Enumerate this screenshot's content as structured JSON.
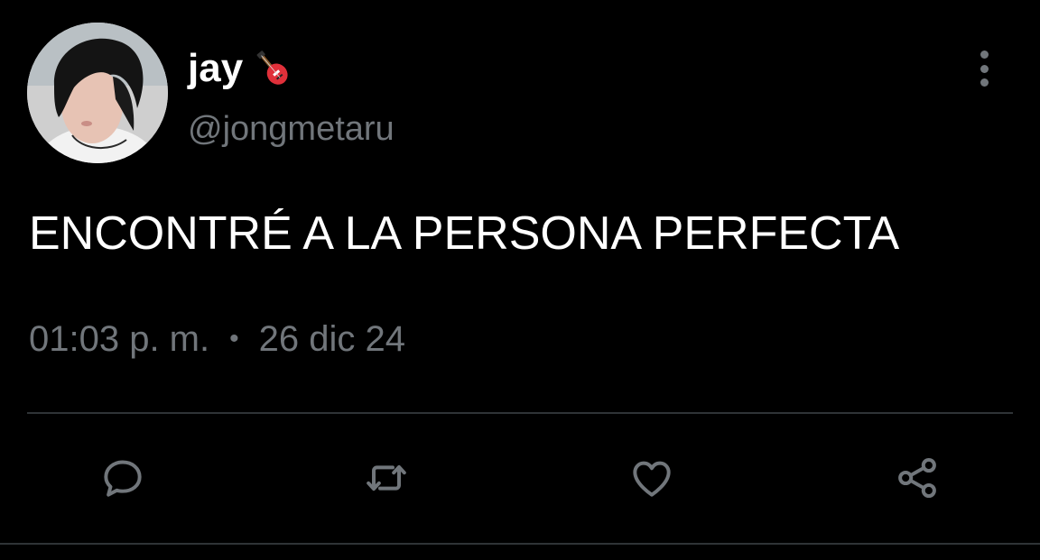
{
  "tweet": {
    "author": {
      "display_name": "jay",
      "name_emoji": "guitar-emoji",
      "handle": "@jongmetaru"
    },
    "text": "ENCONTRÉ A LA PERSONA PERFECTA",
    "time": "01:03 p. m.",
    "separator": "•",
    "date": "26 dic 24"
  },
  "actions": {
    "reply_icon": "speech-bubble-icon",
    "retweet_icon": "retweet-icon",
    "like_icon": "heart-icon",
    "share_icon": "share-icon"
  },
  "colors": {
    "background": "#000000",
    "primary_text": "#ffffff",
    "secondary_text": "#71767b",
    "divider": "#2f3336"
  }
}
